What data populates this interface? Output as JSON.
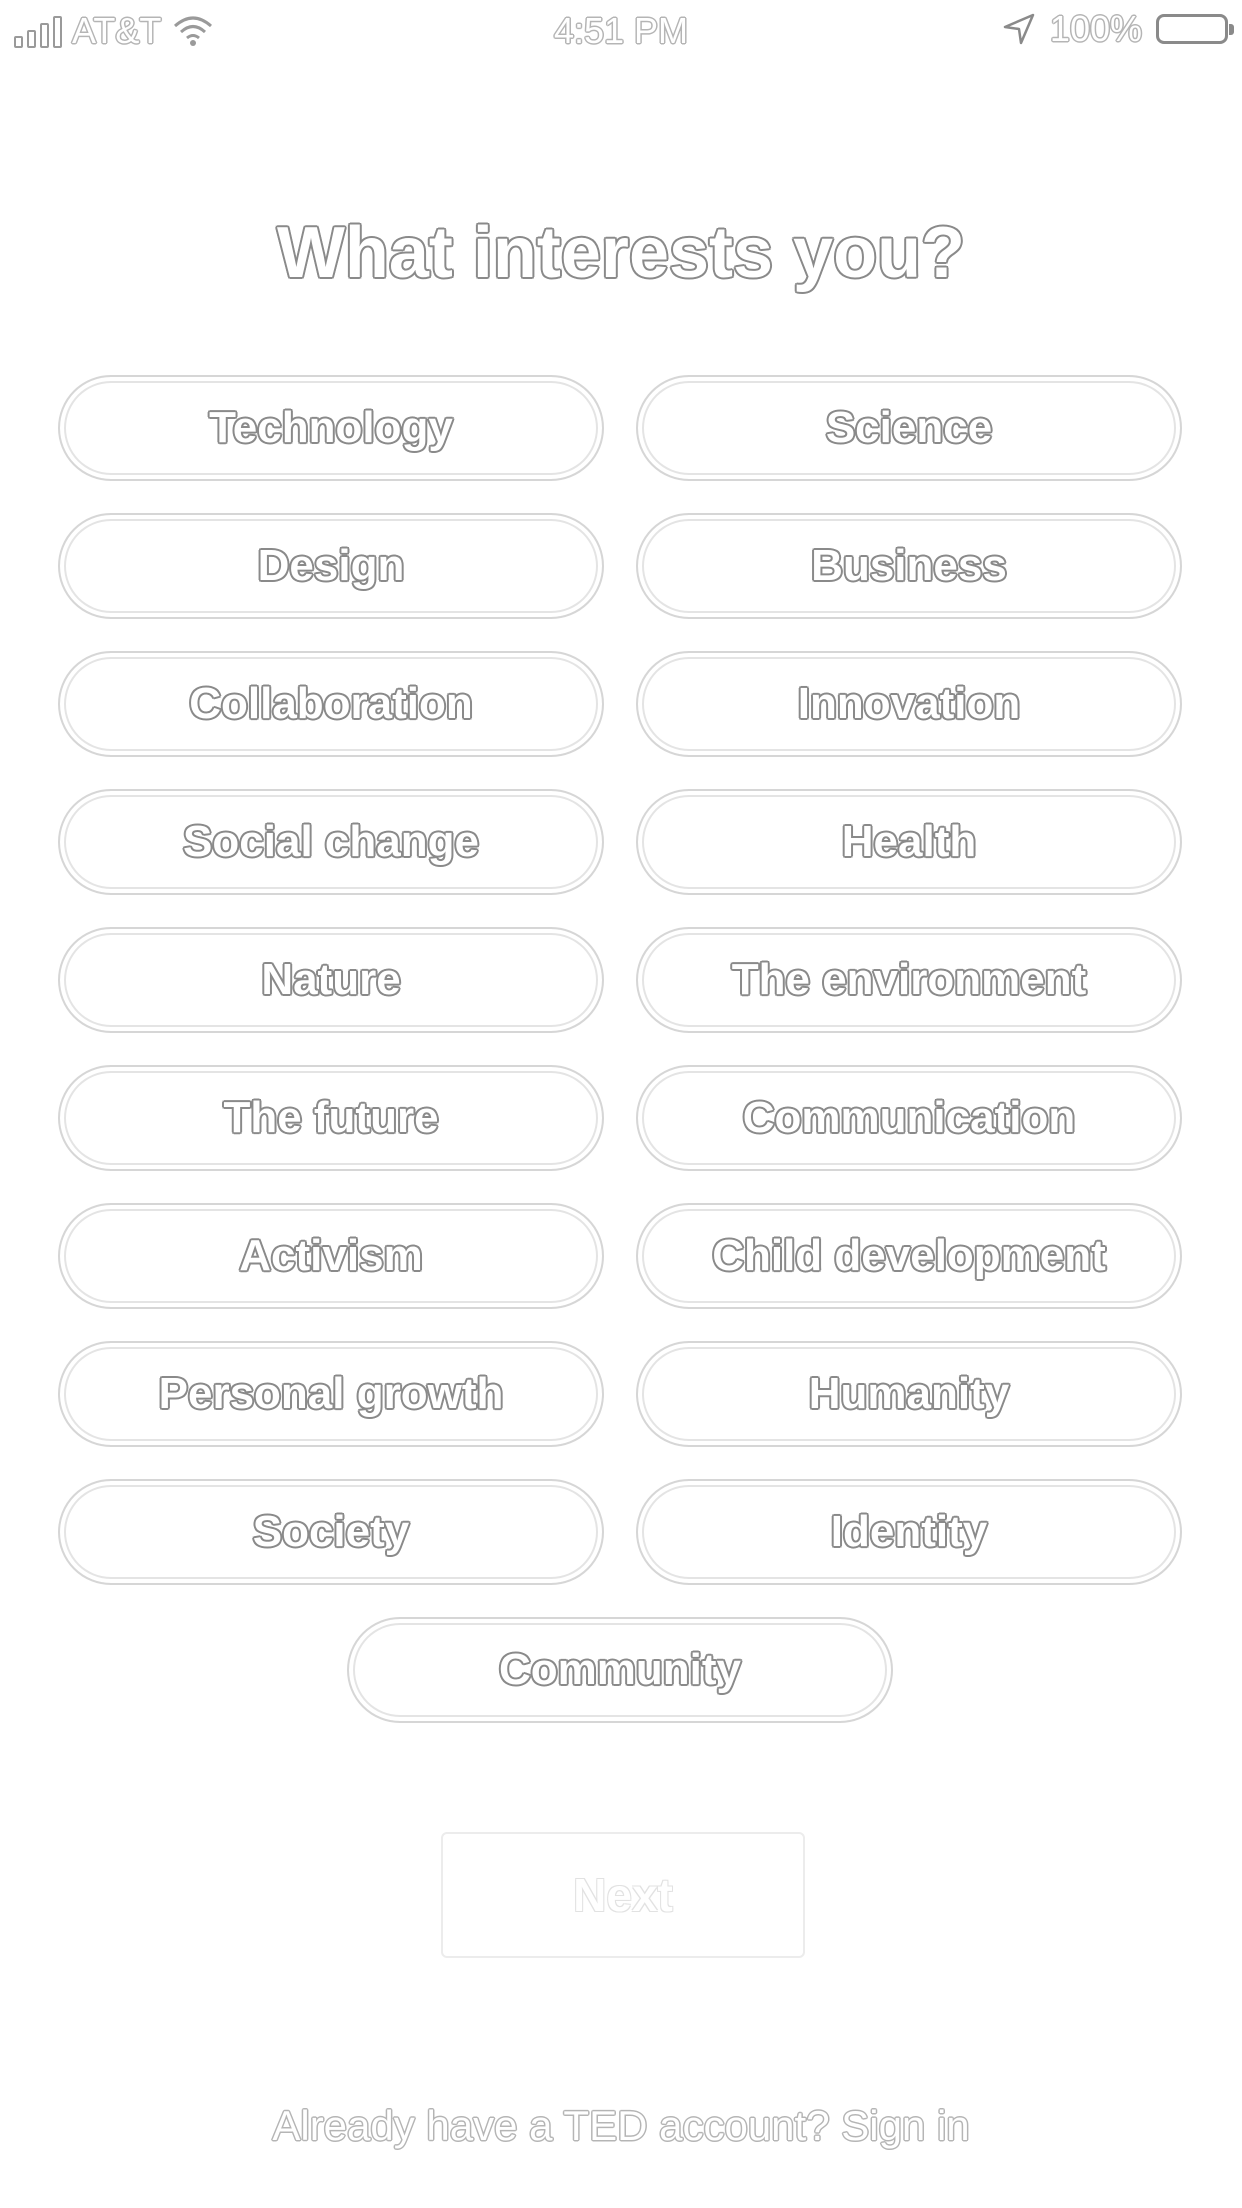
{
  "status_bar": {
    "carrier": "AT&T",
    "time": "4:51 PM",
    "battery": "100%"
  },
  "title": "What interests you?",
  "topics": [
    "Technology",
    "Science",
    "Design",
    "Business",
    "Collaboration",
    "Innovation",
    "Social change",
    "Health",
    "Nature",
    "The environment",
    "The future",
    "Communication",
    "Activism",
    "Child development",
    "Personal growth",
    "Humanity",
    "Society",
    "Identity",
    "Community"
  ],
  "next_label": "Next",
  "signin_text": "Already have a TED account? Sign in"
}
